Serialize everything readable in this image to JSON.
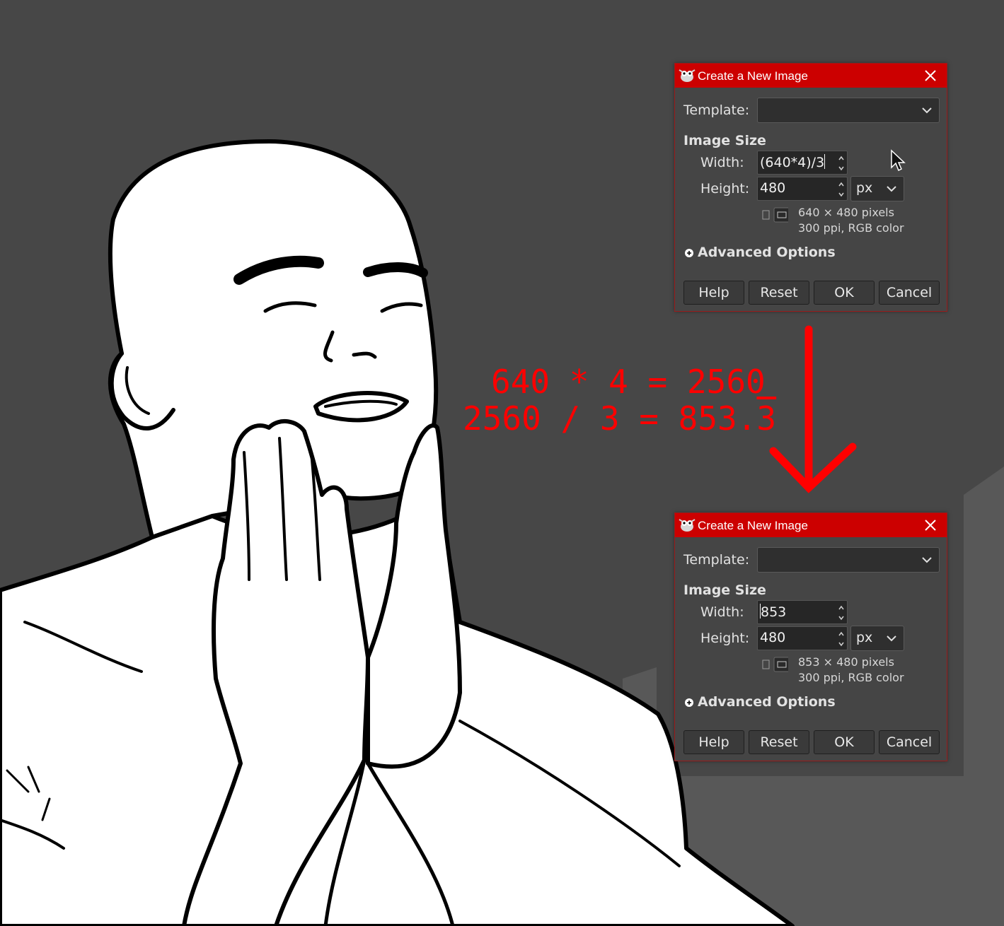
{
  "background_color": "#474747",
  "accent_color": "#cc0000",
  "annotation_color": "#ff0000",
  "annotation": {
    "line1": "640 * 4 = 2560",
    "line2_prefix": "2560 / 3 = 853.",
    "line2_repeating_digit": "3"
  },
  "dialogs": [
    {
      "title": "Create a New Image",
      "template_label": "Template:",
      "template_value": "",
      "image_size_label": "Image Size",
      "width_label": "Width:",
      "width_value": "(640*4)/3",
      "height_label": "Height:",
      "height_value": "480",
      "unit": "px",
      "info_line1": "640 × 480 pixels",
      "info_line2": "300 ppi, RGB color",
      "advanced_label": "Advanced Options",
      "buttons": {
        "help": "Help",
        "reset": "Reset",
        "ok": "OK",
        "cancel": "Cancel"
      }
    },
    {
      "title": "Create a New Image",
      "template_label": "Template:",
      "template_value": "",
      "image_size_label": "Image Size",
      "width_label": "Width:",
      "width_value": "853",
      "height_label": "Height:",
      "height_value": "480",
      "unit": "px",
      "info_line1": "853 × 480 pixels",
      "info_line2": "300 ppi, RGB color",
      "advanced_label": "Advanced Options",
      "buttons": {
        "help": "Help",
        "reset": "Reset",
        "ok": "OK",
        "cancel": "Cancel"
      }
    }
  ],
  "icons": [
    "gimp-wilber-icon",
    "close-icon",
    "chevron-down-icon",
    "spin-arrows-icon",
    "portrait-icon",
    "landscape-icon",
    "expander-icon",
    "mouse-cursor-icon",
    "down-arrow-icon"
  ]
}
